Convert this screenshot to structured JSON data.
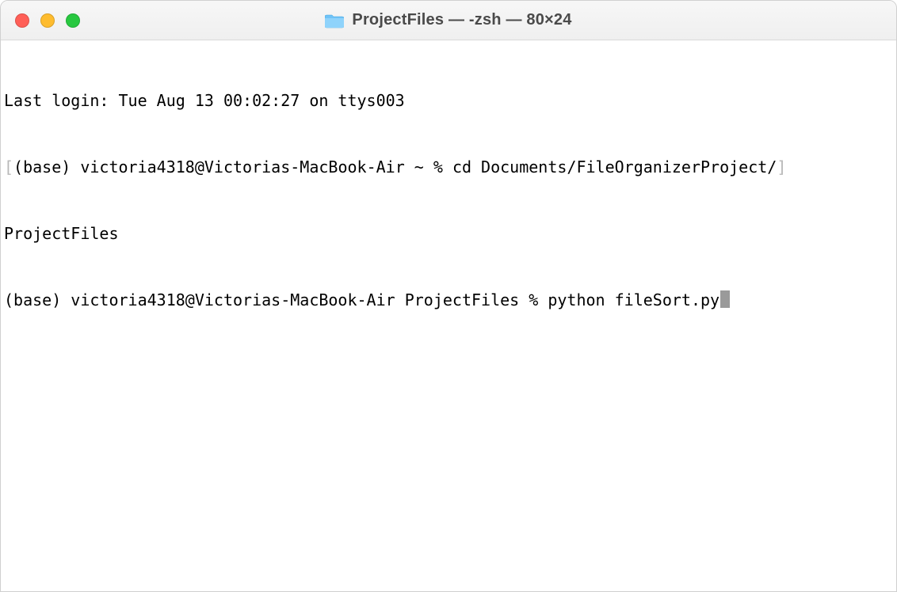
{
  "window": {
    "title": "ProjectFiles — -zsh — 80×24"
  },
  "traffic_lights": {
    "close": "close",
    "minimize": "minimize",
    "maximize": "maximize"
  },
  "terminal": {
    "last_login": "Last login: Tue Aug 13 00:02:27 on ttys003",
    "prompt1_pre": "(base) victoria4318@Victorias-MacBook-Air ~ % ",
    "cmd1": "cd Documents/FileOrganizerProject/",
    "cmd1_wrap": "ProjectFiles",
    "prompt2_pre": "(base) victoria4318@Victorias-MacBook-Air ProjectFiles % ",
    "cmd2": "python fileSort.py",
    "wrap_left": "[",
    "wrap_right": "]"
  }
}
